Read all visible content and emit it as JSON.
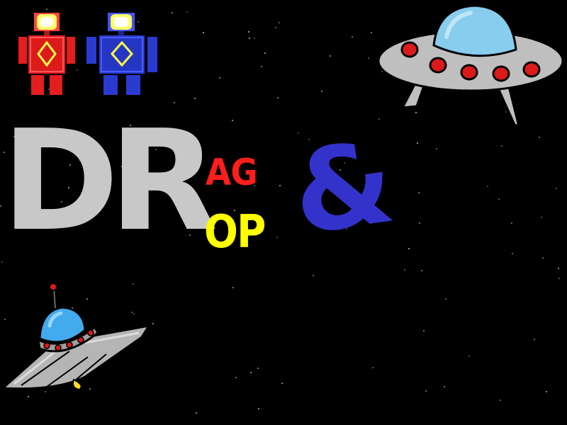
{
  "title": {
    "part1": "DR",
    "part2": "AG",
    "part3": "OP",
    "ampersand": "&",
    "colors": {
      "dr": "#c8c8c8",
      "ag": "#ff1e1e",
      "op": "#ffff00",
      "ampersand": "#3333cc"
    }
  },
  "sprites": {
    "robot_red": {
      "icon": "robot-icon",
      "color": "#e41e1e"
    },
    "robot_blue": {
      "icon": "robot-icon",
      "color": "#2a3ad0"
    },
    "ufo_large": {
      "icon": "ufo-icon",
      "color": "#bfbfbf"
    },
    "ufo_small": {
      "icon": "ufo-icon",
      "color": "#b5b5b5"
    }
  },
  "background": {
    "color": "#000000",
    "starfield": true
  }
}
